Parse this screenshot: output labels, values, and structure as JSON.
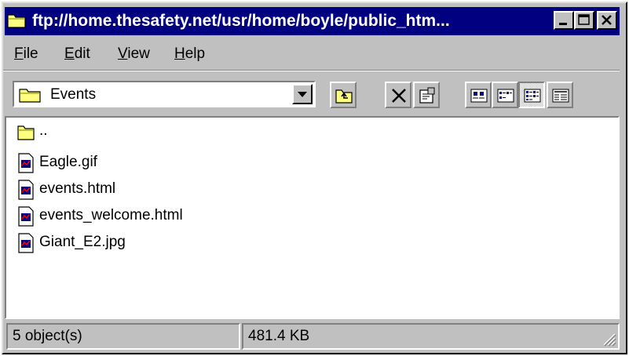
{
  "window": {
    "title": "ftp://home.thesafety.net/usr/home/boyle/public_htm...",
    "controls": {
      "minimize": "minimize",
      "maximize": "maximize",
      "close": "close"
    }
  },
  "menubar": {
    "items": [
      {
        "accel": "F",
        "rest": "ile"
      },
      {
        "accel": "E",
        "rest": "dit"
      },
      {
        "accel": "V",
        "rest": "iew"
      },
      {
        "accel": "H",
        "rest": "elp"
      }
    ]
  },
  "toolbar": {
    "address": "Events",
    "buttons": [
      "up-one-level",
      "delete",
      "properties",
      "large-icons",
      "small-icons",
      "list",
      "details"
    ],
    "pressed": "list"
  },
  "files": [
    {
      "name": "..",
      "type": "folder"
    },
    {
      "name": "Eagle.gif",
      "type": "file"
    },
    {
      "name": "events.html",
      "type": "file"
    },
    {
      "name": "events_welcome.html",
      "type": "file"
    },
    {
      "name": "Giant_E2.jpg",
      "type": "file"
    }
  ],
  "status": {
    "objects": "5 object(s)",
    "size": "481.4 KB"
  },
  "colors": {
    "title_bar": "#000080",
    "face": "#c0c0c0",
    "folder": "#ffff80"
  }
}
